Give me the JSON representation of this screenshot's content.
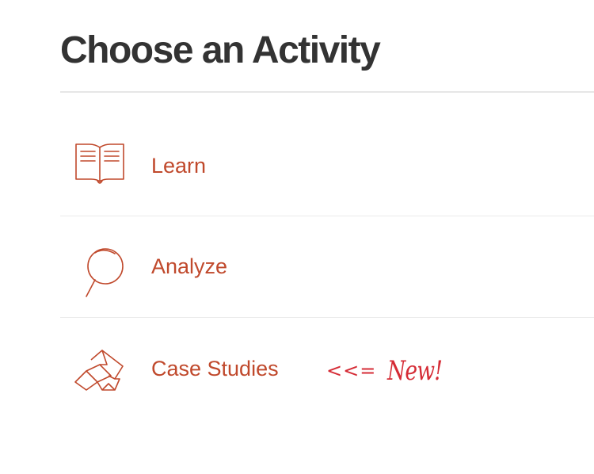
{
  "page": {
    "title": "Choose an Activity"
  },
  "activities": [
    {
      "label": "Learn",
      "icon": "book-icon"
    },
    {
      "label": "Analyze",
      "icon": "magnifying-glass-icon"
    },
    {
      "label": "Case Studies",
      "icon": "blocks-icon"
    }
  ],
  "annotation": {
    "arrow": "<<=",
    "text": "New!"
  },
  "colors": {
    "title": "#333333",
    "accent": "#c0492c",
    "annotation": "#d52b35",
    "divider": "#e6e6e6"
  }
}
